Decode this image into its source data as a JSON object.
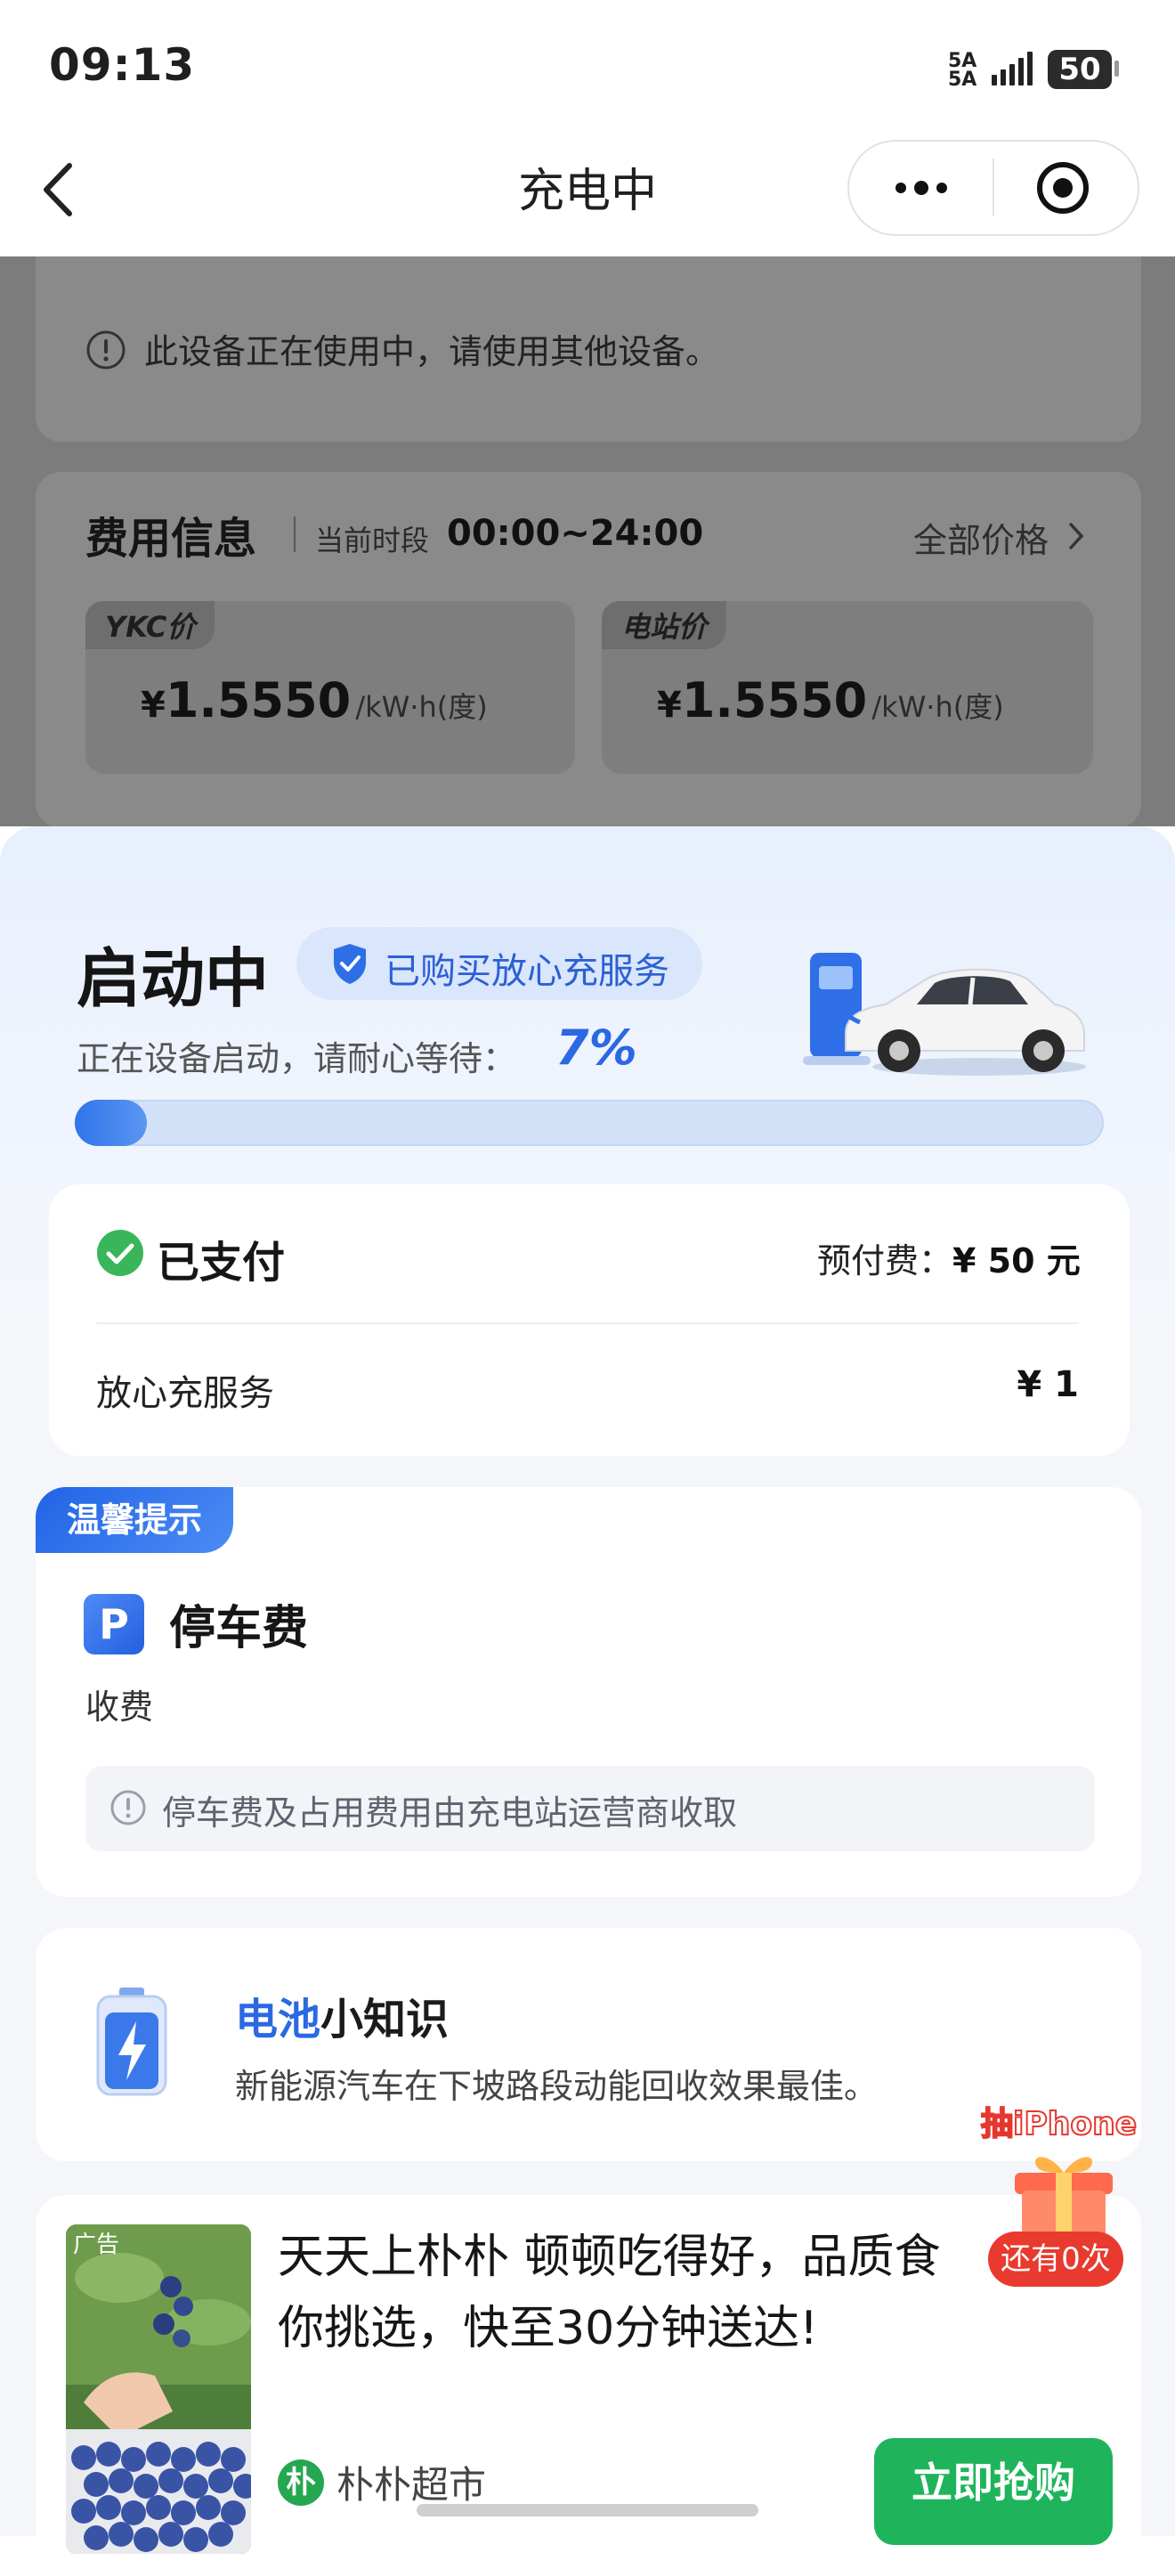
{
  "status_bar": {
    "time": "09:13",
    "signal_text": "5A\n5A",
    "battery": "50"
  },
  "nav": {
    "title": "充电中",
    "back_icon": "chevron-left-icon",
    "more_icon": "more-dots-icon",
    "close_icon": "target-icon"
  },
  "notice": {
    "text": "此设备正在使用中，请使用其他设备。"
  },
  "fee": {
    "title": "费用信息",
    "period_label": "当前时段",
    "period": "00:00~24:00",
    "all_prices": "全部价格",
    "prices": [
      {
        "tag": "YKC价",
        "currency": "¥",
        "amount": "1.5550",
        "unit": "/kW·h(度)"
      },
      {
        "tag": "电站价",
        "currency": "¥",
        "amount": "1.5550",
        "unit": "/kW·h(度)"
      }
    ]
  },
  "status": {
    "title": "启动中",
    "service_badge": "已购买放心充服务",
    "wait_text": "正在设备启动，请耐心等待：",
    "percent": "7%",
    "progress": 0.07
  },
  "payment": {
    "paid_label": "已支付",
    "prepay_label": "预付费：",
    "prepay_value": "¥ 50 元",
    "service_label": "放心充服务",
    "service_value": "¥ 1"
  },
  "tip": {
    "badge": "温馨提示",
    "parking_icon_letter": "P",
    "parking_title": "停车费",
    "parking_sub": "收费",
    "note": "停车费及占用费用由充电站运营商收取"
  },
  "knowledge": {
    "title_blue": "电池",
    "title_rest": "小知识",
    "text": "新能源汽车在下坡路段动能回收效果最佳。"
  },
  "ad": {
    "tag": "广告",
    "headline": "天天上朴朴 顿顿吃得好，品质食\n你挑选，快至30分钟送达!",
    "avatar_char": "朴",
    "brand": "朴朴超市",
    "cta": "立即抢购"
  },
  "gift": {
    "label": "抽iPhone",
    "remaining": "还有0次"
  },
  "colors": {
    "accent": "#2b68e3",
    "green": "#1fb45b",
    "red": "#e83a2e"
  }
}
